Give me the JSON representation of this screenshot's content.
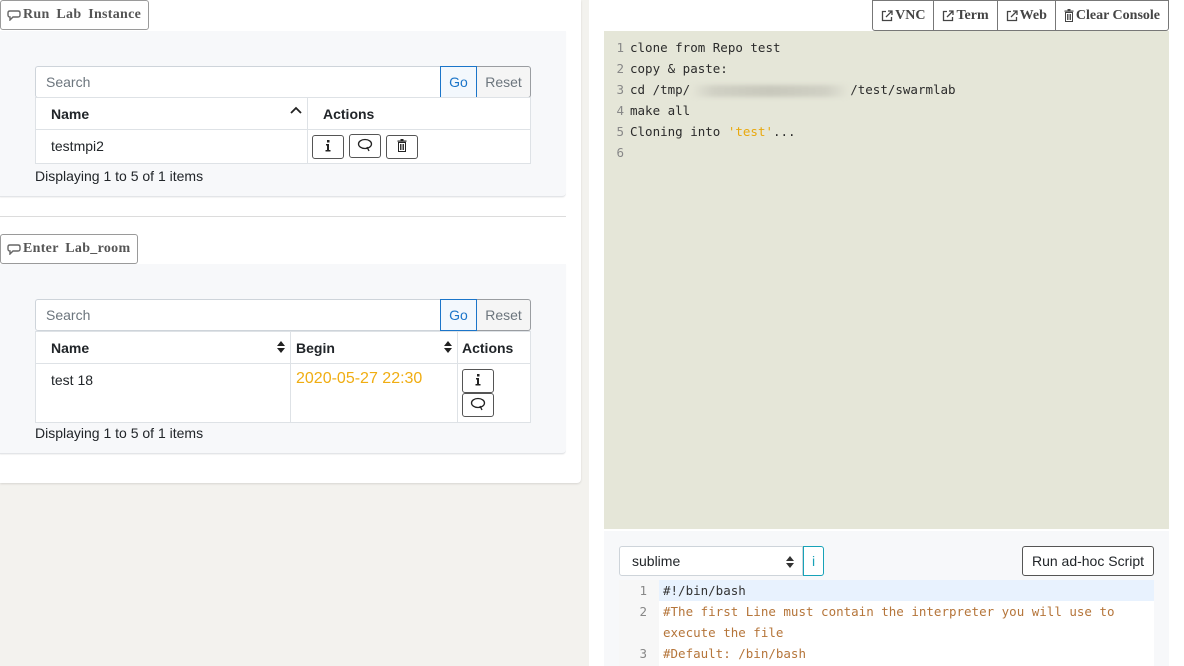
{
  "lab_instance": {
    "button_label": "Run Lab Instance",
    "search": {
      "placeholder": "Search",
      "go_label": "Go",
      "reset_label": "Reset"
    },
    "columns": [
      "Name",
      "Actions"
    ],
    "rows": [
      {
        "name": "testmpi2"
      }
    ],
    "footer": "Displaying 1 to 5 of 1 items"
  },
  "lab_room": {
    "button_label": "Enter Lab_room",
    "search": {
      "placeholder": "Search",
      "go_label": "Go",
      "reset_label": "Reset"
    },
    "columns": [
      "Name",
      "Begin",
      "Actions"
    ],
    "rows": [
      {
        "name": "test 18",
        "begin": "2020-05-27 22:30"
      }
    ],
    "footer": "Displaying 1 to 5 of 1 items"
  },
  "console_toolbar": {
    "vnc_label": "VNC",
    "term_label": "Term",
    "web_label": "Web",
    "clear_label": "Clear Console"
  },
  "console": {
    "lines": [
      {
        "num": "1",
        "text": "clone from Repo test"
      },
      {
        "num": "2",
        "text": "copy & paste:"
      },
      {
        "num": "3",
        "prefix": "cd /tmp/",
        "suffix": "/test/swarmlab"
      },
      {
        "num": "4",
        "text": "make all"
      },
      {
        "num": "5",
        "prefix": "Cloning into ",
        "string": "'test'",
        "suffix": "..."
      },
      {
        "num": "6",
        "text": ""
      }
    ]
  },
  "editor": {
    "theme_select": "sublime",
    "info_label": "i",
    "run_label": "Run ad-hoc Script",
    "lines": [
      {
        "num": "1",
        "text": "#!/bin/bash"
      },
      {
        "num": "2",
        "text": "#The first Line must contain the interpreter you will use to"
      },
      {
        "num": "",
        "text": "execute the file"
      },
      {
        "num": "3",
        "text": "#Default: /bin/bash"
      }
    ]
  },
  "colors": {
    "date_highlight": "#f0ad12",
    "console_background": "#e5e6d8",
    "primary": "#1b75c9",
    "info": "#17a2b8"
  }
}
